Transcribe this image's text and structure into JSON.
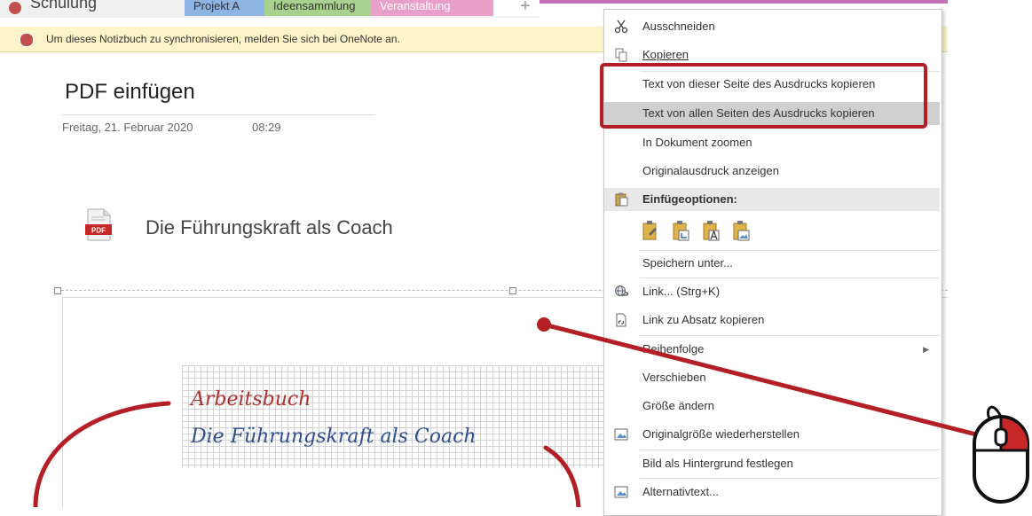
{
  "tabs": {
    "notebook": "Schulung",
    "items": [
      "Projekt A",
      "Ideensammlung",
      "Veranstaltung",
      "+"
    ]
  },
  "infobar": {
    "text": "Um dieses Notizbuch zu synchronisieren, melden Sie sich bei OneNote an."
  },
  "page": {
    "title": "PDF einfügen",
    "date": "Freitag, 21. Februar 2020",
    "time": "08:29",
    "attachment_name": "Die Führungskraft als Coach",
    "pdf_icon_label": "PDF"
  },
  "printout": {
    "line1": "Arbeitsbuch",
    "line2": "Die Führungskraft als Coach"
  },
  "context_menu": {
    "cut": "Ausschneiden",
    "copy": "Kopieren",
    "copy_page_text": "Text von dieser Seite des Ausdrucks kopieren",
    "copy_all_text": "Text von allen Seiten des Ausdrucks kopieren",
    "zoom_document": "In Dokument zoomen",
    "show_original": "Originalausdruck anzeigen",
    "paste_options": "Einfügeoptionen:",
    "save_as": "Speichern unter...",
    "link": "Link...  (Strg+K)",
    "copy_link_paragraph": "Link zu Absatz kopieren",
    "order": "Reihenfolge",
    "move": "Verschieben",
    "resize": "Größe ändern",
    "restore_size": "Originalgröße wiederherstellen",
    "set_background": "Bild als Hintergrund festlegen",
    "alt_text": "Alternativtext..."
  },
  "colors": {
    "annotation_red": "#b31f24",
    "pdf_red": "#c62828",
    "tab_blue": "#8db4e2",
    "tab_green": "#a9d18e",
    "tab_pink": "#e8a0c8",
    "infobar_bg": "#fcf3c9"
  }
}
